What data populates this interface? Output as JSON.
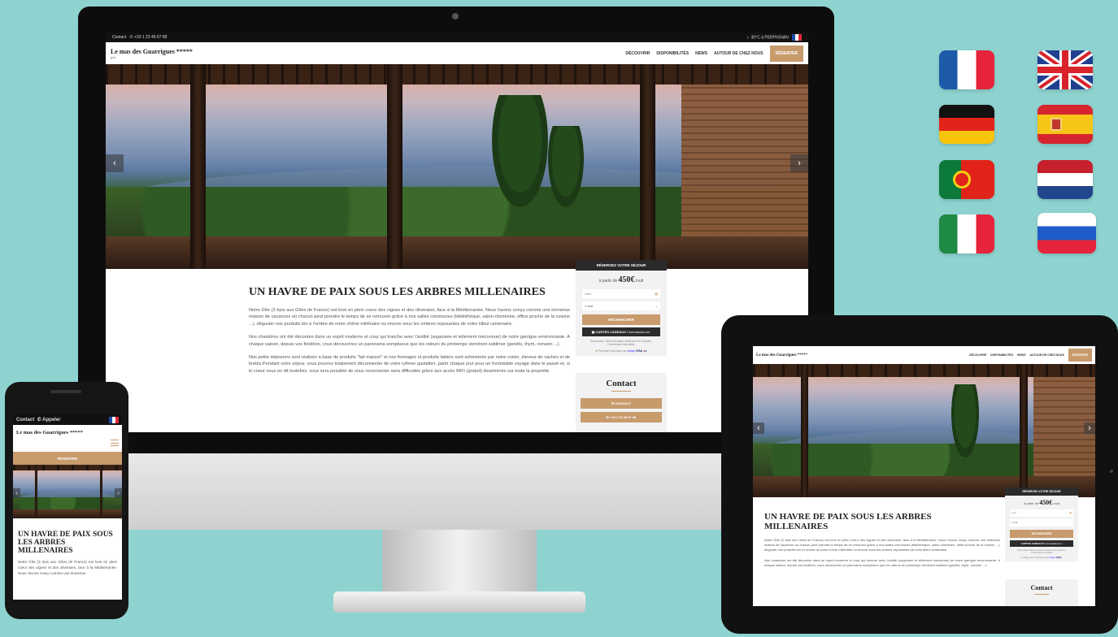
{
  "site": {
    "logo": "Le mas des Guarrigues *****",
    "logo_sub": "gîte",
    "phone": "+33 1 23 45 67 89",
    "contact_link": "Contact",
    "call_link": "Appeler",
    "weather": "30°C à PERPIGNAN"
  },
  "nav": {
    "items": [
      "DÉCOUVRIR",
      "DISPONIBILITÉS",
      "NEWS",
      "AUTOUR DE CHEZ NOUS"
    ],
    "cta": "RÉSERVER"
  },
  "hero": {
    "prev": "‹",
    "next": "›"
  },
  "article": {
    "title": "UN HAVRE DE PAIX SOUS LES ARBRES MILLENAIRES",
    "p1": "Notre Gîte (3 épis aux Gîtes de France) est lové en plein coeur des vignes et des oliveraies, face à la Méditerranée. Nous l'avons conçu comme une immense maison de vacances où chacun peut prendre le temps de se retrouver grâce à nos salles communes (bibliothèque, salon-cheminée, office proche de la cuisine ...), déguster nos produits bio à l'ombre de notre chêne millénaire ou encore sous les ombres reposantes de notre tilleul centenaire.",
    "p2": "Nos chambres ont été décorées dans un esprit moderne et cosy qui tranche avec l'aridité (supposée et tellement méconnue) de notre garrigue environnante. A chaque saison, depuis vos fenêtres, vous découvrirez un panorama somptueux que les odeurs du printemps viendront sublimer (genêts, thym, romarin ...).",
    "p3": "Nos petits déjeuners sont réalisés à base de produits \"fait maison\" et nos fromages et produits laitiers sont acheminés par notre voisin, éleveur de vaches et de brebis.Pendant votre séjour, vous pourrez totalement déconnecter de votre rythme quotidien, partir chaque jour pour un formidable voyage dans le passé et, si le coeur vous en dit toutefois, vous sera possible de vous reconnecter sans difficultés grâce aux accès WiFi (gratuit) disséminés sur toute la propriété."
  },
  "booking": {
    "header": "RÉSERVEZ VOTRE SÉJOUR",
    "price_prefix": "à partir de",
    "price": "450€",
    "price_suffix": "/nuit",
    "date_placeholder": "Date",
    "nights_value": "1 nuit",
    "search_btn": "RECHERCHER",
    "gift_btn": "CARTES CADEAUX",
    "gift_sub": "Commandez-la !",
    "secure_note": "Réservation 100% sécurisée, Meilleure Prix Garantie, Confirmation immédiate",
    "payment_note": "Paiement sécurisé par",
    "payment_brands": [
      "stripe",
      "VISA"
    ]
  },
  "contact": {
    "title": "Contact",
    "btn_contact": "CONTACT",
    "btn_phone": "+33 1 23 45 67 89"
  },
  "mobile": {
    "title": "UN HAVRE DE PAIX SOUS LES ARBRES MILLENAIRES",
    "text": "Notre Gîte (3 épis aux Gîtes de France) est lové en plein coeur des vignes et des oliveraies, face à la Méditerranée. Nous l'avons conçu comme une immense"
  },
  "flags": [
    "France",
    "United Kingdom",
    "Germany",
    "Spain",
    "Portugal",
    "Netherlands",
    "Italy",
    "Russia"
  ],
  "colors": {
    "background": "#8fd3d0",
    "accent": "#c89b6d",
    "dark": "#2b2b2b"
  }
}
